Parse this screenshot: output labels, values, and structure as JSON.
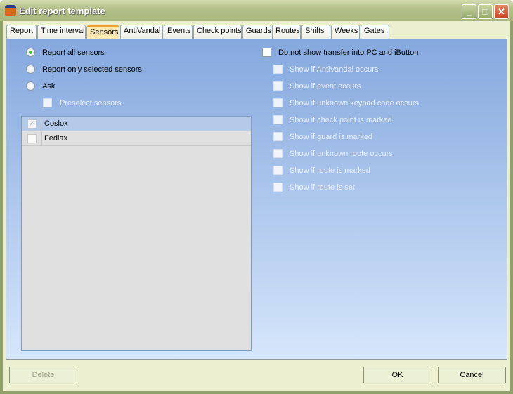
{
  "window": {
    "title": "Edit report template",
    "icon": "guard-icon",
    "controls": [
      "minimize",
      "maximize",
      "close"
    ]
  },
  "tabs": [
    {
      "label": "Report"
    },
    {
      "label": "Time interval"
    },
    {
      "label": "Sensors",
      "selected": true
    },
    {
      "label": "AntiVandal"
    },
    {
      "label": "Events"
    },
    {
      "label": "Check points"
    },
    {
      "label": "Guards"
    },
    {
      "label": "Routes"
    },
    {
      "label": "Shifts"
    },
    {
      "label": "Weeks"
    },
    {
      "label": "Gates"
    }
  ],
  "sensors": {
    "radios": [
      {
        "label": "Report all sensors",
        "checked": true
      },
      {
        "label": "Report only selected sensors",
        "checked": false
      },
      {
        "label": "Ask",
        "checked": false
      }
    ],
    "preselect": {
      "label": "Preselect sensors",
      "checked": false,
      "disabled": true
    },
    "list": [
      {
        "name": "Coslox",
        "checked": true,
        "selected": true
      },
      {
        "name": "Fedlax",
        "checked": false
      }
    ]
  },
  "transfer": {
    "main": {
      "label": "Do not show transfer into PC and iButton",
      "checked": false
    },
    "options": [
      {
        "label": "Show if AntiVandal occurs"
      },
      {
        "label": "Show if event occurs"
      },
      {
        "label": "Show if unknown keypad code occurs"
      },
      {
        "label": "Show if check point is marked"
      },
      {
        "label": "Show if guard is marked"
      },
      {
        "label": "Show if unknown route occurs"
      },
      {
        "label": "Show if route is marked"
      },
      {
        "label": "Show if route is set"
      }
    ]
  },
  "buttons": {
    "delete": "Delete",
    "ok": "OK",
    "cancel": "Cancel"
  }
}
